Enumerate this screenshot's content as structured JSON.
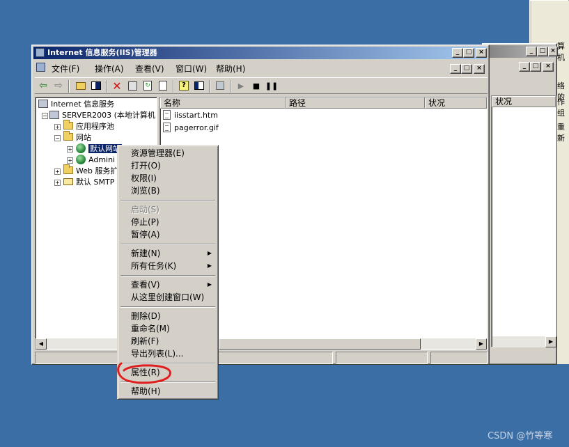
{
  "window": {
    "title": "Internet 信息服务(IIS)管理器",
    "min_label": "_",
    "max_label": "□",
    "close_label": "×"
  },
  "menubar": {
    "items": [
      "文件(F)",
      "操作(A)",
      "查看(V)",
      "窗口(W)",
      "帮助(H)"
    ]
  },
  "tree": {
    "root": "Internet 信息服务",
    "server": "SERVER2003 (本地计算机",
    "app_pools": "应用程序池",
    "websites": "网站",
    "default_site": "默认网站",
    "admin_site": "Admini",
    "web_ext": "Web 服务扩",
    "smtp": "默认 SMTP"
  },
  "list": {
    "columns": [
      "名称",
      "路径",
      "状况"
    ],
    "files": [
      "iisstart.htm",
      "pagerror.gif"
    ]
  },
  "back_window": {
    "col_status": "状况",
    "partial_text": [
      "算机",
      "络的",
      "作组",
      "重新"
    ]
  },
  "context_menu": {
    "items": [
      {
        "label": "资源管理器(E)",
        "disabled": false,
        "submenu": false
      },
      {
        "label": "打开(O)",
        "disabled": false,
        "submenu": false
      },
      {
        "label": "权限(I)",
        "disabled": false,
        "submenu": false
      },
      {
        "label": "浏览(B)",
        "disabled": false,
        "submenu": false
      },
      {
        "label": "启动(S)",
        "disabled": true,
        "submenu": false
      },
      {
        "label": "停止(P)",
        "disabled": false,
        "submenu": false
      },
      {
        "label": "暂停(A)",
        "disabled": false,
        "submenu": false
      },
      {
        "label": "新建(N)",
        "disabled": false,
        "submenu": true
      },
      {
        "label": "所有任务(K)",
        "disabled": false,
        "submenu": true
      },
      {
        "label": "查看(V)",
        "disabled": false,
        "submenu": true
      },
      {
        "label": "从这里创建窗口(W)",
        "disabled": false,
        "submenu": false
      },
      {
        "label": "删除(D)",
        "disabled": false,
        "submenu": false
      },
      {
        "label": "重命名(M)",
        "disabled": false,
        "submenu": false
      },
      {
        "label": "刷新(F)",
        "disabled": false,
        "submenu": false
      },
      {
        "label": "导出列表(L)...",
        "disabled": false,
        "submenu": false
      },
      {
        "label": "属性(R)",
        "disabled": false,
        "submenu": false
      },
      {
        "label": "帮助(H)",
        "disabled": false,
        "submenu": false
      }
    ]
  },
  "watermark": "CSDN @竹等寒",
  "colors": {
    "desktop": "#3a6ea5",
    "title_active": "#0a246a",
    "selection": "#0a246a",
    "annotation": "#e02020"
  }
}
